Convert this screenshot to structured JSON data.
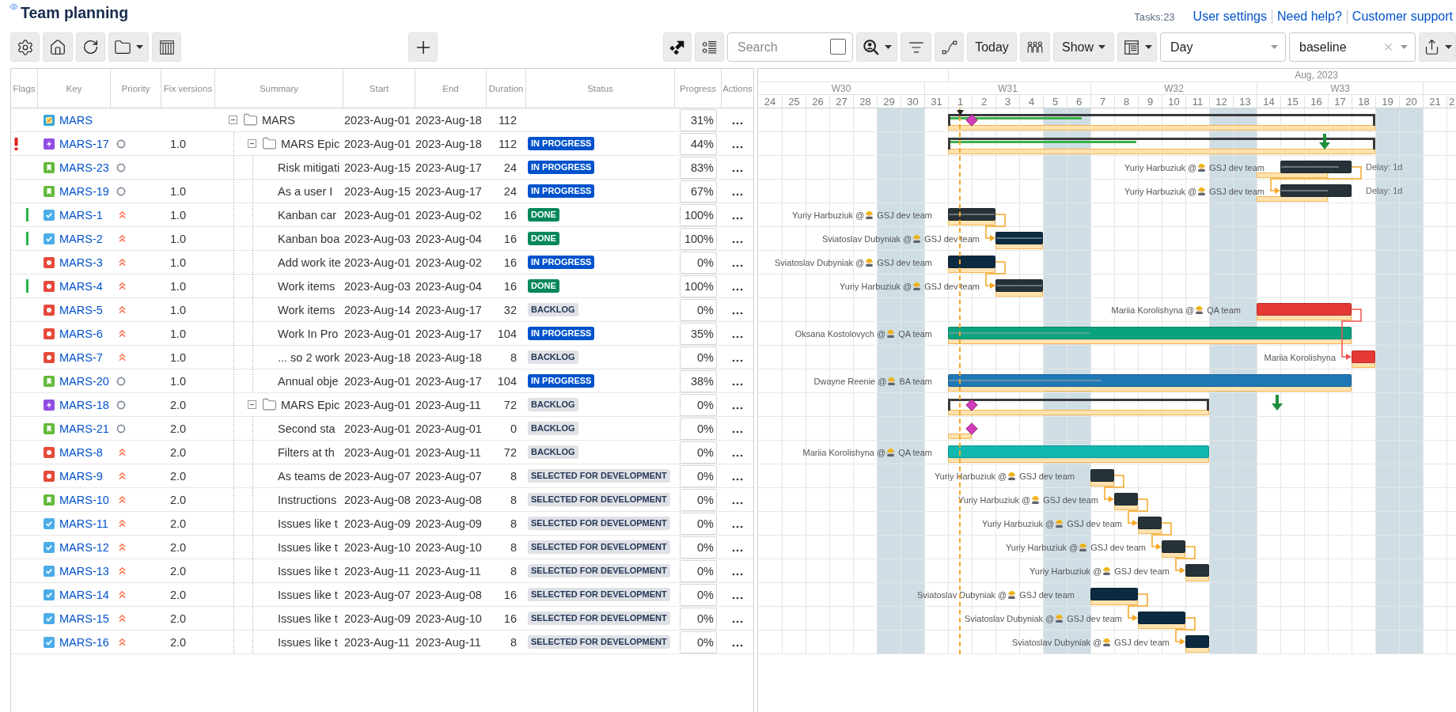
{
  "header": {
    "title": "Team planning",
    "task_count": "Tasks:23",
    "links": [
      "User settings",
      "Need help?",
      "Customer support"
    ]
  },
  "toolbar": {
    "search": {
      "placeholder": "Search",
      "checked": false
    },
    "today_button": "Today",
    "show_button": "Show",
    "scale_select": "Day",
    "baseline_select": "baseline"
  },
  "table": {
    "columns": [
      "Flags",
      "Key",
      "Priority",
      "Fix versions",
      "Summary",
      "Start",
      "End",
      "Duration",
      "Status",
      "Progress",
      "Actions"
    ],
    "rows": [
      {
        "kind": "project",
        "key": "MARS",
        "flagged": false,
        "resolved": false,
        "summary": "MARS",
        "expanded": true,
        "start": "2023-Aug-01",
        "end": "2023-Aug-18",
        "duration": "112",
        "progress": "31%",
        "gantt": {
          "kind": "summary",
          "level": 0.31,
          "baseline": true
        },
        "children": [
          {
            "kind": "epic",
            "key": "MARS-17",
            "flagged": true,
            "resolved": false,
            "priority": {
              "kind": "medium"
            },
            "fix_version": "1.0",
            "summary": "MARS Epic",
            "expanded": true,
            "start": "2023-Aug-01",
            "end": "2023-Aug-18",
            "duration": "112",
            "status": {
              "label": "IN PROGRESS",
              "color": "#0052cc"
            },
            "progress": "44%",
            "gantt": {
              "kind": "summary",
              "level": 0.44,
              "baseline": true,
              "deadline": {
                "level": 0.796
              }
            },
            "children": [
              {
                "kind": "story",
                "key": "MARS-23",
                "flagged": false,
                "resolved": false,
                "priority": {
                  "kind": "medium"
                },
                "summary": "Risk mitigati",
                "start": "2023-Aug-15",
                "end": "2023-Aug-17",
                "duration": "24",
                "status": {
                  "label": "IN PROGRESS",
                  "color": "#0052cc"
                },
                "progress": "83%",
                "gantt": {
                  "kind": "task",
                  "level": 0.83,
                  "color": "#263238",
                  "baseline": true,
                  "assignee": "Yuriy Harbuziuk @",
                  "team": "GSJ dev team",
                  "note": "Delay: 1d"
                }
              },
              {
                "kind": "story",
                "key": "MARS-19",
                "flagged": false,
                "resolved": false,
                "priority": {
                  "kind": "medium"
                },
                "fix_version": "1.0",
                "summary": "As a user I",
                "start": "2023-Aug-15",
                "end": "2023-Aug-17",
                "duration": "24",
                "status": {
                  "label": "IN PROGRESS",
                  "color": "#0052cc"
                },
                "progress": "67%",
                "gantt": {
                  "kind": "task",
                  "level": 0.67,
                  "color": "#263238",
                  "baseline": true,
                  "assignee": "Yuriy Harbuziuk @",
                  "team": "GSJ dev team",
                  "note": "Delay: 1d",
                  "link": {
                    "kind": "previous",
                    "critical": false
                  }
                }
              },
              {
                "kind": "task",
                "key": "MARS-1",
                "flagged": false,
                "resolved": true,
                "priority": {
                  "kind": "high"
                },
                "fix_version": "1.0",
                "summary": "Kanban car",
                "start": "2023-Aug-01",
                "end": "2023-Aug-02",
                "duration": "16",
                "status": {
                  "label": "DONE",
                  "color": "#00875a"
                },
                "progress": "100%",
                "gantt": {
                  "kind": "task",
                  "level": 1,
                  "color": "#263238",
                  "baseline": true,
                  "assignee": "Yuriy Harbuziuk @",
                  "team": "GSJ dev team"
                }
              },
              {
                "kind": "task",
                "key": "MARS-2",
                "flagged": false,
                "resolved": true,
                "priority": {
                  "kind": "high"
                },
                "fix_version": "1.0",
                "summary": "Kanban boa",
                "start": "2023-Aug-03",
                "end": "2023-Aug-04",
                "duration": "16",
                "status": {
                  "label": "DONE",
                  "color": "#00875a"
                },
                "progress": "100%",
                "gantt": {
                  "kind": "task",
                  "level": 1,
                  "color": "#0c2a40",
                  "baseline": true,
                  "assignee": "Sviatoslav Dubyniak @",
                  "team": "GSJ dev team",
                  "link": {
                    "kind": "previous",
                    "critical": false
                  }
                }
              },
              {
                "kind": "bug",
                "key": "MARS-3",
                "flagged": false,
                "resolved": false,
                "priority": {
                  "kind": "high"
                },
                "fix_version": "1.0",
                "summary": "Add work ite",
                "start": "2023-Aug-01",
                "end": "2023-Aug-02",
                "duration": "16",
                "status": {
                  "label": "IN PROGRESS",
                  "color": "#0052cc"
                },
                "progress": "0%",
                "gantt": {
                  "kind": "task",
                  "color": "#0c2a40",
                  "baseline": true,
                  "assignee": "Sviatoslav Dubyniak @",
                  "team": "GSJ dev team"
                }
              },
              {
                "kind": "bug",
                "key": "MARS-4",
                "flagged": false,
                "resolved": true,
                "priority": {
                  "kind": "high"
                },
                "fix_version": "1.0",
                "summary": "Work items",
                "start": "2023-Aug-03",
                "end": "2023-Aug-04",
                "duration": "16",
                "status": {
                  "label": "DONE",
                  "color": "#00875a"
                },
                "progress": "100%",
                "gantt": {
                  "kind": "task",
                  "level": 1,
                  "color": "#263238",
                  "baseline": true,
                  "assignee": "Yuriy Harbuziuk @",
                  "team": "GSJ dev team",
                  "link": {
                    "kind": "previous",
                    "critical": false
                  }
                }
              },
              {
                "kind": "bug",
                "key": "MARS-5",
                "flagged": false,
                "resolved": false,
                "priority": {
                  "kind": "high"
                },
                "fix_version": "1.0",
                "summary": "Work items",
                "start": "2023-Aug-14",
                "end": "2023-Aug-17",
                "duration": "32",
                "status": {
                  "label": "BACKLOG",
                  "color": "#dfe1e6"
                },
                "progress": "0%",
                "gantt": {
                  "kind": "task",
                  "color": "#e53935",
                  "baseline": true,
                  "assignee": "Mariia Korolishyna @",
                  "team": "QA team"
                }
              },
              {
                "kind": "bug",
                "key": "MARS-6",
                "flagged": false,
                "resolved": false,
                "priority": {
                  "kind": "high"
                },
                "fix_version": "1.0",
                "summary": "Work In Pro",
                "start": "2023-Aug-01",
                "end": "2023-Aug-17",
                "duration": "104",
                "status": {
                  "label": "IN PROGRESS",
                  "color": "#0052cc"
                },
                "progress": "35%",
                "gantt": {
                  "kind": "task",
                  "level": 0.35,
                  "color": "#0aa37f",
                  "baseline": true,
                  "assignee": "Oksana Kostolovych @",
                  "team": "QA team"
                }
              },
              {
                "kind": "bug",
                "key": "MARS-7",
                "flagged": false,
                "resolved": false,
                "priority": {
                  "kind": "high"
                },
                "fix_version": "1.0",
                "summary": "... so 2 work",
                "start": "2023-Aug-18",
                "end": "2023-Aug-18",
                "duration": "8",
                "status": {
                  "label": "BACKLOG",
                  "color": "#dfe1e6"
                },
                "progress": "0%",
                "gantt": {
                  "kind": "task",
                  "color": "#e53935",
                  "baseline": true,
                  "assignee": "Mariia Korolishyna",
                  "link": {
                    "kind": "second_previous",
                    "critical": true
                  }
                }
              },
              {
                "kind": "story",
                "key": "MARS-20",
                "flagged": false,
                "resolved": false,
                "priority": {
                  "kind": "medium"
                },
                "fix_version": "1.0",
                "summary": "Annual obje",
                "start": "2023-Aug-01",
                "end": "2023-Aug-17",
                "duration": "104",
                "status": {
                  "label": "IN PROGRESS",
                  "color": "#0052cc"
                },
                "progress": "38%",
                "gantt": {
                  "kind": "task",
                  "level": 0.38,
                  "color": "#1f78b4",
                  "baseline": true,
                  "assignee": "Dwayne Reenie @",
                  "team": "BA team"
                }
              }
            ]
          },
          {
            "kind": "epic",
            "key": "MARS-18",
            "flagged": false,
            "resolved": false,
            "priority": {
              "kind": "medium"
            },
            "fix_version": "2.0",
            "summary": "MARS Epic",
            "expanded": true,
            "start": "2023-Aug-01",
            "end": "2023-Aug-11",
            "duration": "72",
            "status": {
              "label": "BACKLOG",
              "color": "#dfe1e6"
            },
            "progress": "0%",
            "gantt": {
              "kind": "summary",
              "baseline": true,
              "deadline": {
                "level": 0.729
              }
            },
            "children": [
              {
                "kind": "story",
                "key": "MARS-21",
                "flagged": false,
                "resolved": false,
                "priority": {
                  "kind": "medium"
                },
                "fix_version": "2.0",
                "summary": "Second sta",
                "start": "2023-Aug-01",
                "end": "2023-Aug-01",
                "duration": "0",
                "status": {
                  "label": "BACKLOG",
                  "color": "#dfe1e6"
                },
                "progress": "0%",
                "gantt": {
                  "kind": "milestone",
                  "baseline": true
                }
              },
              {
                "kind": "bug",
                "key": "MARS-8",
                "flagged": false,
                "resolved": false,
                "priority": {
                  "kind": "high"
                },
                "fix_version": "2.0",
                "summary": "Filters at th",
                "start": "2023-Aug-01",
                "end": "2023-Aug-11",
                "duration": "72",
                "status": {
                  "label": "BACKLOG",
                  "color": "#dfe1e6"
                },
                "progress": "0%",
                "gantt": {
                  "kind": "task",
                  "color": "#12b8b0",
                  "baseline": true,
                  "assignee": "Mariia Korolishyna @",
                  "team": "QA team"
                }
              },
              {
                "kind": "bug",
                "key": "MARS-9",
                "flagged": false,
                "resolved": false,
                "priority": {
                  "kind": "high"
                },
                "fix_version": "2.0",
                "summary": "As teams de",
                "start": "2023-Aug-07",
                "end": "2023-Aug-07",
                "duration": "8",
                "status": {
                  "label": "SELECTED FOR DEVELOPMENT",
                  "color": "#dfe1e6"
                },
                "progress": "0%",
                "gantt": {
                  "kind": "task",
                  "color": "#263238",
                  "baseline": true,
                  "assignee": "Yuriy Harbuziuk @",
                  "team": "GSJ dev team"
                }
              },
              {
                "kind": "story",
                "key": "MARS-10",
                "flagged": false,
                "resolved": false,
                "priority": {
                  "kind": "high"
                },
                "fix_version": "2.0",
                "summary": "Instructions",
                "start": "2023-Aug-08",
                "end": "2023-Aug-08",
                "duration": "8",
                "status": {
                  "label": "SELECTED FOR DEVELOPMENT",
                  "color": "#dfe1e6"
                },
                "progress": "0%",
                "gantt": {
                  "kind": "task",
                  "color": "#263238",
                  "baseline": true,
                  "assignee": "Yuriy Harbuziuk @",
                  "team": "GSJ dev team",
                  "link": {
                    "kind": "previous",
                    "critical": false
                  }
                }
              },
              {
                "kind": "task",
                "key": "MARS-11",
                "flagged": false,
                "resolved": false,
                "priority": {
                  "kind": "high"
                },
                "fix_version": "2.0",
                "summary": "Issues like t",
                "start": "2023-Aug-09",
                "end": "2023-Aug-09",
                "duration": "8",
                "status": {
                  "label": "SELECTED FOR DEVELOPMENT",
                  "color": "#dfe1e6"
                },
                "progress": "0%",
                "gantt": {
                  "kind": "task",
                  "color": "#263238",
                  "baseline": true,
                  "assignee": "Yuriy Harbuziuk @",
                  "team": "GSJ dev team",
                  "link": {
                    "kind": "previous",
                    "critical": false
                  }
                }
              },
              {
                "kind": "task",
                "key": "MARS-12",
                "flagged": false,
                "resolved": false,
                "priority": {
                  "kind": "high"
                },
                "fix_version": "2.0",
                "summary": "Issues like t",
                "start": "2023-Aug-10",
                "end": "2023-Aug-10",
                "duration": "8",
                "status": {
                  "label": "SELECTED FOR DEVELOPMENT",
                  "color": "#dfe1e6"
                },
                "progress": "0%",
                "gantt": {
                  "kind": "task",
                  "color": "#263238",
                  "baseline": true,
                  "assignee": "Yuriy Harbuziuk @",
                  "team": "GSJ dev team",
                  "link": {
                    "kind": "previous",
                    "critical": false
                  }
                }
              },
              {
                "kind": "task",
                "key": "MARS-13",
                "flagged": false,
                "resolved": false,
                "priority": {
                  "kind": "high"
                },
                "fix_version": "2.0",
                "summary": "Issues like t",
                "start": "2023-Aug-11",
                "end": "2023-Aug-11",
                "duration": "8",
                "status": {
                  "label": "SELECTED FOR DEVELOPMENT",
                  "color": "#dfe1e6"
                },
                "progress": "0%",
                "gantt": {
                  "kind": "task",
                  "color": "#263238",
                  "baseline": true,
                  "assignee": "Yuriy Harbuziuk @",
                  "team": "GSJ dev team",
                  "link": {
                    "kind": "previous",
                    "critical": false
                  }
                }
              },
              {
                "kind": "task",
                "key": "MARS-14",
                "flagged": false,
                "resolved": false,
                "priority": {
                  "kind": "high"
                },
                "fix_version": "2.0",
                "summary": "Issues like t",
                "start": "2023-Aug-07",
                "end": "2023-Aug-08",
                "duration": "16",
                "status": {
                  "label": "SELECTED FOR DEVELOPMENT",
                  "color": "#dfe1e6"
                },
                "progress": "0%",
                "gantt": {
                  "kind": "task",
                  "color": "#0c2a40",
                  "baseline": true,
                  "assignee": "Sviatoslav Dubyniak @",
                  "team": "GSJ dev team"
                }
              },
              {
                "kind": "task",
                "key": "MARS-15",
                "flagged": false,
                "resolved": false,
                "priority": {
                  "kind": "high"
                },
                "fix_version": "2.0",
                "summary": "Issues like t",
                "start": "2023-Aug-09",
                "end": "2023-Aug-10",
                "duration": "16",
                "status": {
                  "label": "SELECTED FOR DEVELOPMENT",
                  "color": "#dfe1e6"
                },
                "progress": "0%",
                "gantt": {
                  "kind": "task",
                  "color": "#0c2a40",
                  "baseline": true,
                  "assignee": "Sviatoslav Dubyniak @",
                  "team": "GSJ dev team",
                  "link": {
                    "kind": "previous",
                    "critical": false
                  }
                }
              },
              {
                "kind": "task",
                "key": "MARS-16",
                "flagged": false,
                "resolved": false,
                "priority": {
                  "kind": "high"
                },
                "fix_version": "2.0",
                "summary": "Issues like t",
                "start": "2023-Aug-11",
                "end": "2023-Aug-11",
                "duration": "8",
                "status": {
                  "label": "SELECTED FOR DEVELOPMENT",
                  "color": "#dfe1e6"
                },
                "progress": "0%",
                "gantt": {
                  "kind": "task",
                  "color": "#0c2a40",
                  "baseline": true,
                  "assignee": "Sviatoslav Dubyniak @",
                  "team": "GSJ dev team",
                  "link": {
                    "kind": "previous",
                    "critical": false
                  }
                }
              }
            ]
          }
        ]
      }
    ]
  },
  "gantt": {
    "month_label": "Aug, 2023",
    "weeks": [
      "W30",
      "W31",
      "W32",
      "W33"
    ],
    "days": [
      {
        "label": "24",
        "weekend": false,
        "today": false
      },
      {
        "label": "25",
        "weekend": false,
        "today": false
      },
      {
        "label": "26",
        "weekend": false,
        "today": false
      },
      {
        "label": "27",
        "weekend": false,
        "today": false
      },
      {
        "label": "28",
        "weekend": false,
        "today": false
      },
      {
        "label": "29",
        "weekend": true,
        "today": false
      },
      {
        "label": "30",
        "weekend": true,
        "today": false
      },
      {
        "label": "31",
        "weekend": false,
        "today": false
      },
      {
        "label": "1",
        "weekend": false,
        "today": true
      },
      {
        "label": "2",
        "weekend": false,
        "today": false
      },
      {
        "label": "3",
        "weekend": false,
        "today": false
      },
      {
        "label": "4",
        "weekend": false,
        "today": false
      },
      {
        "label": "5",
        "weekend": true,
        "today": false
      },
      {
        "label": "6",
        "weekend": true,
        "today": false
      },
      {
        "label": "7",
        "weekend": false,
        "today": false
      },
      {
        "label": "8",
        "weekend": false,
        "today": false
      },
      {
        "label": "9",
        "weekend": false,
        "today": false
      },
      {
        "label": "10",
        "weekend": false,
        "today": false
      },
      {
        "label": "11",
        "weekend": false,
        "today": false
      },
      {
        "label": "12",
        "weekend": true,
        "today": false
      },
      {
        "label": "13",
        "weekend": true,
        "today": false
      },
      {
        "label": "14",
        "weekend": false,
        "today": false
      },
      {
        "label": "15",
        "weekend": false,
        "today": false
      },
      {
        "label": "16",
        "weekend": false,
        "today": false
      },
      {
        "label": "17",
        "weekend": false,
        "today": false
      },
      {
        "label": "18",
        "weekend": false,
        "today": false
      },
      {
        "label": "19",
        "weekend": true,
        "today": false
      },
      {
        "label": "20",
        "weekend": true,
        "today": false
      },
      {
        "label": "21",
        "weekend": false,
        "today": false
      },
      {
        "label": "2",
        "weekend": false,
        "today": false
      }
    ]
  }
}
